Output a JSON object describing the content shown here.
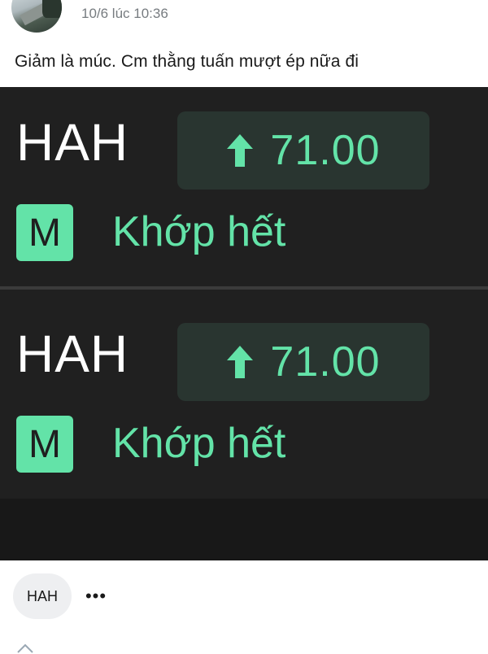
{
  "post": {
    "timestamp": "10/6 lúc 10:36",
    "caption": "Giảm là múc. Cm thằng tuấn mượt ép nữa đi"
  },
  "screenshot": {
    "rows": [
      {
        "ticker": "HAH",
        "price": "71.00",
        "price_direction": "up",
        "match_type_badge": "M",
        "status": "Khớp hết"
      },
      {
        "ticker": "HAH",
        "price": "71.00",
        "price_direction": "up",
        "match_type_badge": "M",
        "status": "Khớp hết"
      }
    ],
    "colors": {
      "background": "#202020",
      "accent_green": "#63e3a8",
      "price_box": "#293530"
    }
  },
  "tags": [
    {
      "label": "HAH"
    }
  ],
  "more_menu": {
    "label": "•••"
  },
  "icons": {
    "arrow": "arrow-up-icon",
    "more": "more-horizontal-icon"
  }
}
